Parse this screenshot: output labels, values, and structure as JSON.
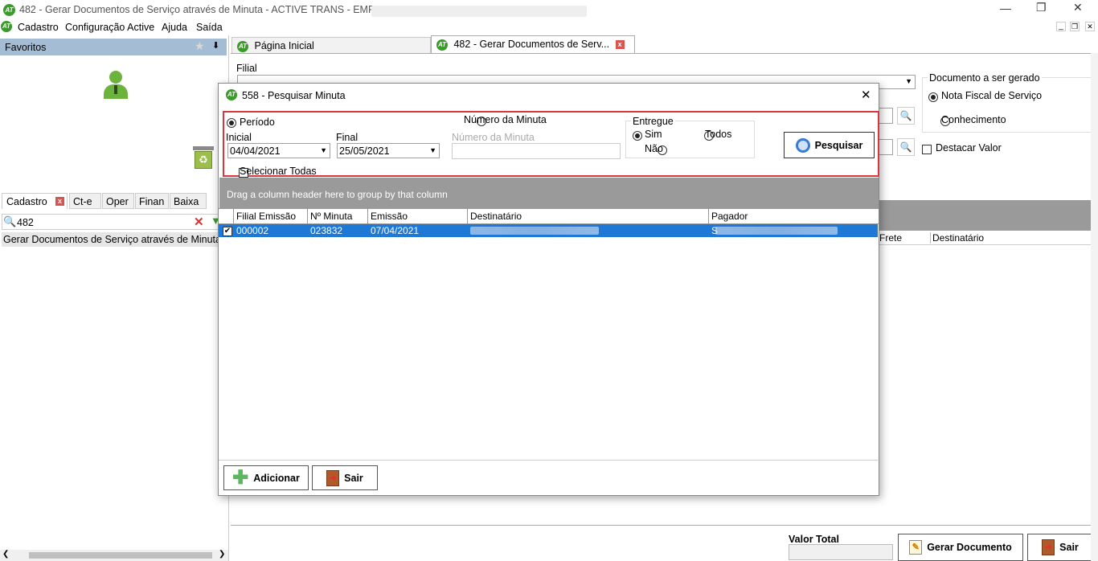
{
  "window": {
    "title": "482 - Gerar Documentos de Serviço através de Minuta - ACTIVE TRANS - EMPRESA:",
    "logo_text": "AT"
  },
  "menubar": {
    "items": [
      "Cadastro",
      "Configuração Active",
      "Ajuda",
      "Saída"
    ]
  },
  "sidebar": {
    "favoritos_label": "Favoritos",
    "tabs": [
      "Cadastro",
      "Ct-e",
      "Oper",
      "Finan",
      "Baixa"
    ],
    "search_value": "482",
    "result_item": "Gerar Documentos de Serviço através de Minuta"
  },
  "main_tabs": [
    {
      "label": "Página Inicial"
    },
    {
      "label": "482 - Gerar Documentos de Serv..."
    }
  ],
  "form": {
    "filial_label": "Filial",
    "documento_group_label": "Documento a ser gerado",
    "opt_nota": "Nota Fiscal de Serviço",
    "opt_conhecimento": "Conhecimento",
    "destacar_label": "Destacar Valor",
    "bg_grid_headers": [
      "Frete",
      "Destinatário"
    ],
    "valor_total_label": "Valor Total",
    "gerar_label": "Gerar Documento",
    "sair_label": "Sair"
  },
  "dialog": {
    "title": "558 - Pesquisar Minuta",
    "periodo_label": "Período",
    "inicial_label": "Inicial",
    "inicial_value": "04/04/2021",
    "final_label": "Final",
    "final_value": "25/05/2021",
    "numero_radio_label": "Número da Minuta",
    "numero_field_label": "Número da Minuta",
    "entregue_label": "Entregue",
    "sim_label": "Sim",
    "nao_label": "Não",
    "todos_label": "Todos",
    "pesquisar_label": "Pesquisar",
    "selecionar_todas_label": "Selecionar Todas",
    "group_hint": "Drag a column header here to group by that column",
    "columns": [
      "Filial Emissão",
      "Nº Minuta",
      "Emissão",
      "Destinatário",
      "Pagador"
    ],
    "rows": [
      {
        "filial": "000002",
        "minuta": "023832",
        "emissao": "07/04/2021",
        "pagador_initial": "S"
      }
    ],
    "adicionar_label": "Adicionar",
    "sair_label": "Sair"
  }
}
